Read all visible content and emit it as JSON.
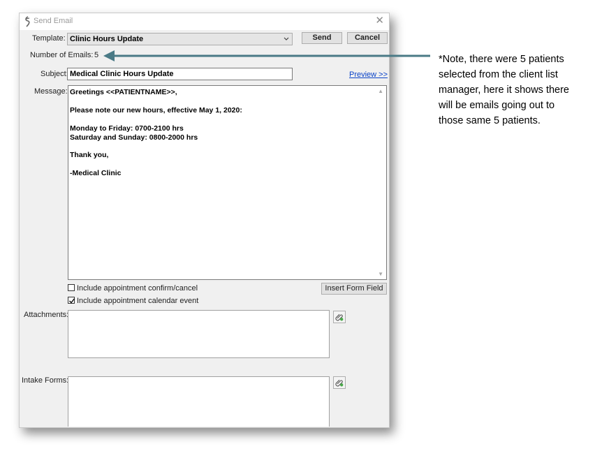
{
  "window": {
    "title": "Send Email",
    "close_glyph": "✕",
    "icon": "app-icon"
  },
  "template": {
    "label": "Template:",
    "value": "Clinic Hours Update"
  },
  "buttons": {
    "send": "Send",
    "cancel": "Cancel",
    "insert_form_field": "Insert Form Field"
  },
  "email_count": {
    "label": "Number of Emails:",
    "value": "5"
  },
  "subject": {
    "label": "Subject:",
    "value": "Medical Clinic Hours Update"
  },
  "preview": {
    "label": "Preview >>"
  },
  "message": {
    "label": "Message:",
    "lines": [
      "Greetings <<PATIENTNAME>>,",
      "",
      "Please note our new hours, effective May 1, 2020:",
      "",
      "Monday to Friday: 0700-2100 hrs",
      "Saturday and Sunday: 0800-2000 hrs",
      "",
      "Thank you,",
      "",
      "-Medical Clinic"
    ]
  },
  "options": {
    "confirm_cancel": {
      "label": "Include appointment confirm/cancel",
      "checked": false
    },
    "calendar_event": {
      "label": "Include appointment calendar event",
      "checked": true
    }
  },
  "attachments": {
    "label": "Attachments:"
  },
  "intake_forms": {
    "label": "Intake Forms:"
  },
  "annotation": {
    "lines": [
      "*Note, there were 5 patients",
      "selected from the client list",
      "manager, here it shows there",
      "will be emails going out to",
      "those same 5 patients."
    ]
  },
  "colors": {
    "arrow": "#4a7a86",
    "link": "#0a43c8",
    "dialog_bg": "#f0f0f0"
  }
}
